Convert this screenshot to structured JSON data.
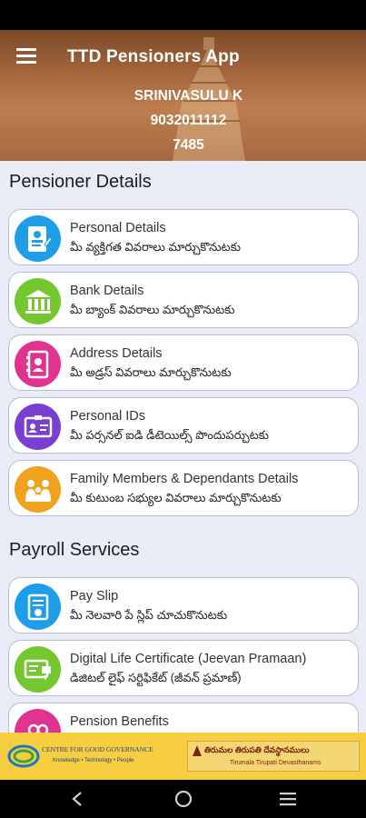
{
  "header": {
    "title": "TTD Pensioners App",
    "name": "SRINIVASULU K",
    "phone": "9032011112",
    "id": "7485"
  },
  "sections": {
    "pensioner_details": "Pensioner Details",
    "payroll_services": "Payroll Services"
  },
  "pensioner_items": [
    {
      "title": "Personal Details",
      "subtitle": "మీ వ్యక్తిగత వివరాలు మార్చుకొనుటకు",
      "icon": "personal-details-icon",
      "color": "#1e9ee9"
    },
    {
      "title": "Bank Details",
      "subtitle": "మీ బ్యాంక్ వివరాలు మార్చుకొనుటకు",
      "icon": "bank-icon",
      "color": "#74c72f"
    },
    {
      "title": "Address Details",
      "subtitle": "మీ అడ్రస్ వివరాలు మార్చుకొనుటకు",
      "icon": "address-book-icon",
      "color": "#e0338f"
    },
    {
      "title": "Personal IDs",
      "subtitle": "మీ పర్సనల్ ఐడి డీటెయిల్స్ పొందుపర్చుటకు",
      "icon": "id-card-icon",
      "color": "#7a3fd0"
    },
    {
      "title": "Family Members & Dependants Details",
      "subtitle": "మీ కుటుంబ సభ్యుల వివరాలు మార్చుకొనుటకు",
      "icon": "family-icon",
      "color": "#f0a21e"
    }
  ],
  "payroll_items": [
    {
      "title": "Pay Slip",
      "subtitle": "మీ నెలవారి పే స్లిప్  చూచుకొనుటకు",
      "icon": "pay-slip-icon",
      "color": "#1e9ee9"
    },
    {
      "title": "Digital Life Certificate (Jeevan Pramaan)",
      "subtitle": "డిజిటల్ లైఫ్ సర్టిఫికేట్ (జీవన్ ప్రమాణ్)",
      "icon": "certificate-icon",
      "color": "#74c72f"
    },
    {
      "title": "Pension Benefits",
      "subtitle": "",
      "icon": "pension-benefits-icon",
      "color": "#e0338f"
    }
  ],
  "footer": {
    "cgg_name": "CENTRE FOR GOOD GOVERNANCE",
    "cgg_tagline": "Knowledge • Technology • People",
    "ttd_telugu": "తిరుమల తిరుపతి దేవస్థానములు",
    "ttd_english": "Tirumala Tirupati Devasthanams"
  },
  "nav": {
    "back": "back-icon",
    "home": "home-icon",
    "recents": "recents-icon"
  }
}
